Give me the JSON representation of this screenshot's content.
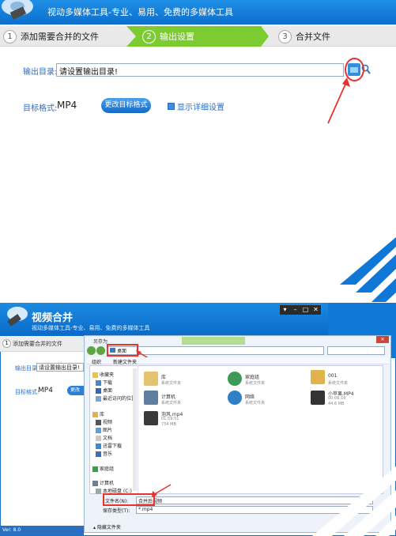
{
  "top": {
    "subtitle": "视动多媒体工具-专业、易用、免费的多媒体工具",
    "steps": [
      {
        "num": "1",
        "label": "添加需要合并的文件"
      },
      {
        "num": "2",
        "label": "输出设置"
      },
      {
        "num": "3",
        "label": "合并文件"
      }
    ],
    "output_dir_label": "输出目录:",
    "output_dir_value": "请设置输出目录!",
    "target_format_label": "目标格式:",
    "target_format_value": "MP4",
    "change_format_button": "更改目标格式",
    "show_details_label": "显示详细设置"
  },
  "bottom": {
    "title": "视频合并",
    "subtitle": "视动多媒体工具-专业、易用、免费的多媒体工具",
    "step1_label": "添加需要合并的文件",
    "output_dir_label": "输出目录:",
    "output_dir_value": "请设置输出目录!",
    "target_format_label": "目标格式:",
    "target_format_value": "MP4",
    "change_btn_partial": "更改",
    "version": "Ver: 8.0",
    "dialog": {
      "title": "另存为",
      "address": "桌面",
      "toolbar_organize": "组织",
      "toolbar_new_folder": "新建文件夹",
      "nav": {
        "favorites_header": "收藏夹",
        "favorites": [
          "下载",
          "桌面",
          "最近访问的位置"
        ],
        "libraries_header": "库",
        "libraries": [
          "视频",
          "图片",
          "文档",
          "迅雷下载",
          "音乐"
        ],
        "homegroup": "家庭组",
        "computer": "计算机",
        "drive": "本地磁盘 (C:)"
      },
      "files": [
        {
          "name": "库",
          "sub": "系统文件夹",
          "icon": "library-icon"
        },
        {
          "name": "家庭组",
          "sub": "系统文件夹",
          "icon": "homegroup-icon"
        },
        {
          "name": "001",
          "sub": "系统文件夹",
          "icon": "user-folder-icon"
        },
        {
          "name": "计算机",
          "sub": "系统文件夹",
          "icon": "computer-icon"
        },
        {
          "name": "网络",
          "sub": "系统文件夹",
          "icon": "network-icon"
        },
        {
          "name": "小苹果.MP4",
          "sub": "00:06:19",
          "sub2": "44.6 MB",
          "icon": "video-icon"
        },
        {
          "name": "泡风.mp4",
          "sub": "01:59:51",
          "sub2": "734 MB",
          "icon": "video-icon"
        }
      ],
      "filename_label": "文件名(N):",
      "filename_value": "合并后视频",
      "filetype_label": "保存类型(T):",
      "filetype_value": "*.mp4",
      "hide_folders": "隐藏文件夹"
    }
  },
  "colors": {
    "accent": "#0b6fce",
    "step_active": "#7ccb30",
    "annotation": "#e8322d"
  }
}
